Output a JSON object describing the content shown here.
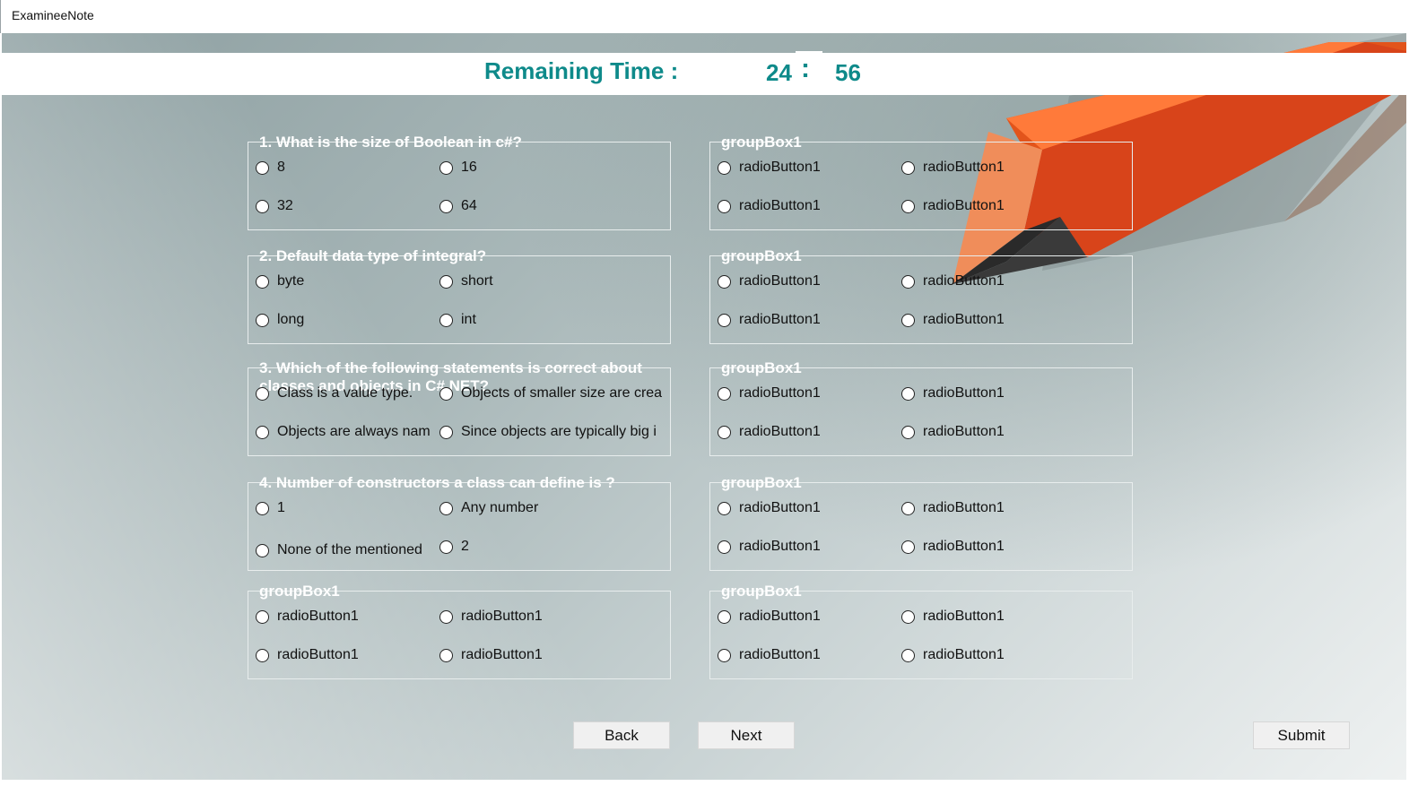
{
  "window": {
    "title": "ExamineeNote"
  },
  "timer": {
    "label": "Remaining Time :",
    "minutes": "24",
    "separator": ":",
    "seconds": "56"
  },
  "groups": [
    {
      "legend": "1. What is the size of Boolean in c#?",
      "options": [
        "8",
        "16",
        "32",
        "64"
      ]
    },
    {
      "legend": "groupBox1",
      "options": [
        "radioButton1",
        "radioButton1",
        "radioButton1",
        "radioButton1"
      ]
    },
    {
      "legend": "2. Default data type of integral?",
      "options": [
        "byte",
        "short",
        "long",
        "int"
      ]
    },
    {
      "legend": "groupBox1",
      "options": [
        "radioButton1",
        "radioButton1",
        "radioButton1",
        "radioButton1"
      ]
    },
    {
      "legend": "3. Which of the following statements is correct about classes and objects in C#.NET?",
      "options": [
        "Class is a value type.",
        "Objects of smaller size are crea",
        "Objects are always nam",
        "Since objects are typically big i"
      ]
    },
    {
      "legend": "groupBox1",
      "options": [
        "radioButton1",
        "radioButton1",
        "radioButton1",
        "radioButton1"
      ]
    },
    {
      "legend": "4. Number of constructors a class can define is ?",
      "options": [
        "1",
        "Any number",
        "None of the mentioned",
        "2"
      ]
    },
    {
      "legend": "groupBox1",
      "options": [
        "radioButton1",
        "radioButton1",
        "radioButton1",
        "radioButton1"
      ]
    },
    {
      "legend": "groupBox1",
      "options": [
        "radioButton1",
        "radioButton1",
        "radioButton1",
        "radioButton1"
      ]
    },
    {
      "legend": "groupBox1",
      "options": [
        "radioButton1",
        "radioButton1",
        "radioButton1",
        "radioButton1"
      ]
    }
  ],
  "buttons": {
    "back": "Back",
    "next": "Next",
    "submit": "Submit"
  }
}
